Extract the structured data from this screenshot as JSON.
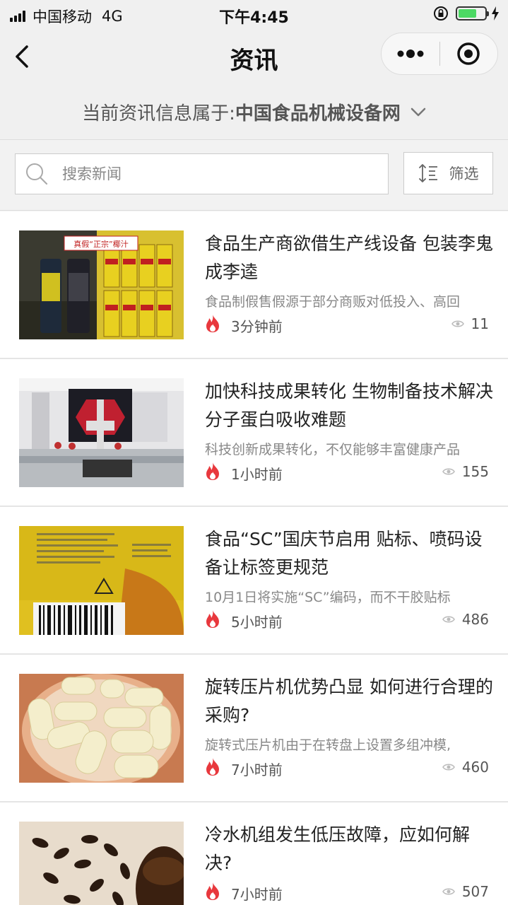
{
  "status_bar": {
    "carrier": "中国移动",
    "network": "4G",
    "time": "下午4:45",
    "battery_level": 0.7,
    "signal_icon": "signal-bars-icon",
    "lock_icon": "rotation-lock-icon",
    "charge_icon": "charging-bolt-icon"
  },
  "nav": {
    "title": "资讯",
    "back_icon": "chevron-left-icon",
    "more_icon": "more-dots-icon",
    "close_icon": "target-close-icon"
  },
  "site": {
    "prefix": "当前资讯信息属于:",
    "name": "中国食品机械设备网",
    "chevron_icon": "chevron-down-icon"
  },
  "search": {
    "placeholder": "搜索新闻",
    "value": "",
    "filter_label": "筛选"
  },
  "colors": {
    "accent_red": "#e8383d",
    "text_main": "#222222",
    "text_muted": "#888888",
    "battery_green": "#4cd964"
  },
  "news": [
    {
      "title": "食品生产商欲借生产线设备 包装李鬼成李逵",
      "summary": "食品制假售假源于部分商贩对低投入、高回",
      "time": "3分钟前",
      "views": "11",
      "thumb_banner": "真假“正宗”椰汁"
    },
    {
      "title": "加快科技成果转化 生物制备技术解决分子蛋白吸收难题",
      "summary": "科技创新成果转化，不仅能够丰富健康产品",
      "time": "1小时前",
      "views": "155"
    },
    {
      "title": "食品“SC”国庆节启用 贴标、喷码设备让标签更规范",
      "summary": "10月1日将实施“SC”编码，而不干胶贴标",
      "time": "5小时前",
      "views": "486"
    },
    {
      "title": "旋转压片机优势凸显 如何进行合理的采购?",
      "summary": "旋转式压片机由于在转盘上设置多组冲模,",
      "time": "7小时前",
      "views": "460"
    },
    {
      "title": "冷水机组发生低压故障，应如何解决?",
      "summary": "",
      "time": "7小时前",
      "views": "507"
    }
  ]
}
